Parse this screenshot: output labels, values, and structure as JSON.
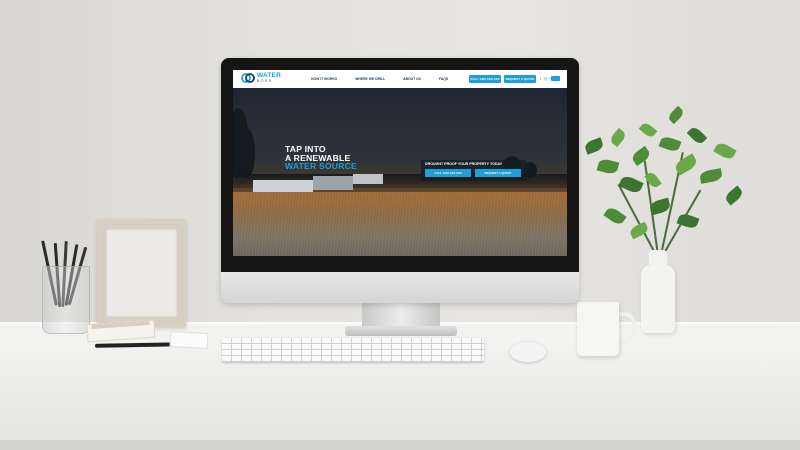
{
  "site": {
    "logo": {
      "word": "WATER",
      "subword": "BOSS",
      "icon": "wb-logo-icon"
    },
    "nav": {
      "links": [
        "HOW IT WORKS",
        "WHERE WE DRILL",
        "ABOUT US",
        "FAQS"
      ],
      "buttons": [
        "CALL 1300 XXX XXX",
        "REQUEST A QUOTE"
      ],
      "social_icons": [
        "facebook-icon",
        "instagram-icon",
        "linkedin-icon"
      ],
      "menu_icon": "menu-toggle-icon"
    },
    "hero": {
      "line1": "TAP INTO",
      "line2": "A RENEWABLE",
      "line3": "WATER SOURCE",
      "cta_title": "DROUGHT PROOF YOUR PROPERTY TODAY",
      "cta_buttons": [
        "CALL 1300 XXX XXX",
        "REQUEST A QUOTE"
      ]
    }
  },
  "colors": {
    "brand_blue": "#1e9fdc",
    "brand_navy": "#1f3b53",
    "wall": "#e4e2de",
    "desk": "#f0f0ee"
  },
  "scene": {
    "objects": [
      "monitor",
      "keyboard",
      "mouse",
      "mug",
      "plant-in-vase",
      "picture-frame",
      "pencil-cup",
      "notepad",
      "pen"
    ]
  }
}
